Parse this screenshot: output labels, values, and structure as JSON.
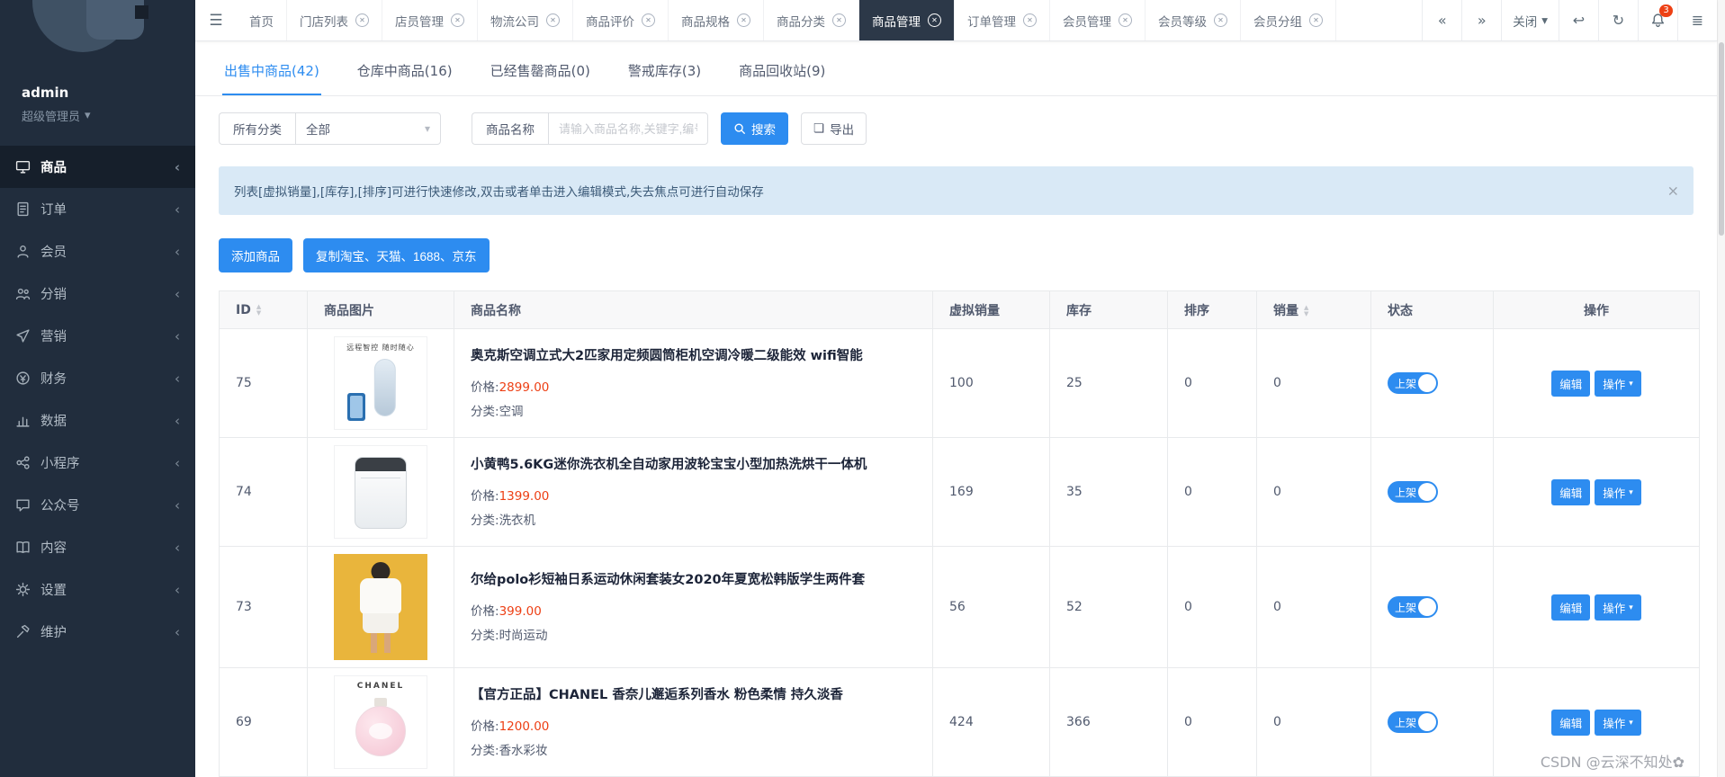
{
  "colors": {
    "accent": "#2d8cf0",
    "price_red": "#ed3f14",
    "sidebar_bg": "#212d3d",
    "badge_red": "#ed4014"
  },
  "icons": {
    "hamburger": "☰",
    "tab_close": "✕",
    "caret_down": "▾",
    "chevron_collapse": "‹",
    "nav_back": "«",
    "nav_forward": "»",
    "undo": "↩",
    "refresh": "↻",
    "list": "≣",
    "sort_up": "▲",
    "sort_down": "▼",
    "export": "❏",
    "close": "×"
  },
  "sidebar": {
    "user_name": "admin",
    "user_role": "超级管理员",
    "items": [
      {
        "label": "商品"
      },
      {
        "label": "订单"
      },
      {
        "label": "会员"
      },
      {
        "label": "分销"
      },
      {
        "label": "营销"
      },
      {
        "label": "财务"
      },
      {
        "label": "数据"
      },
      {
        "label": "小程序"
      },
      {
        "label": "公众号"
      },
      {
        "label": "内容"
      },
      {
        "label": "设置"
      },
      {
        "label": "维护"
      }
    ]
  },
  "navbar": {
    "tabs": [
      {
        "label": "首页"
      },
      {
        "label": "门店列表"
      },
      {
        "label": "店员管理"
      },
      {
        "label": "物流公司"
      },
      {
        "label": "商品评价"
      },
      {
        "label": "商品规格"
      },
      {
        "label": "商品分类"
      },
      {
        "label": "商品管理"
      },
      {
        "label": "订单管理"
      },
      {
        "label": "会员管理"
      },
      {
        "label": "会员等级"
      },
      {
        "label": "会员分组"
      }
    ],
    "close_menu_label": "关闭",
    "notification_count": "3"
  },
  "subtabs": [
    {
      "label": "出售中商品(42)"
    },
    {
      "label": "仓库中商品(16)"
    },
    {
      "label": "已经售罄商品(0)"
    },
    {
      "label": "警戒库存(3)"
    },
    {
      "label": "商品回收站(9)"
    }
  ],
  "filters": {
    "category_label": "所有分类",
    "category_value": "全部",
    "name_label": "商品名称",
    "name_placeholder": "请输入商品名称,关键字,编号",
    "search_label": "搜索",
    "export_label": "导出"
  },
  "alert": {
    "text": "列表[虚拟销量],[库存],[排序]可进行快速修改,双击或者单击进入编辑模式,失去焦点可进行自动保存"
  },
  "toolbar": {
    "add_label": "添加商品",
    "copy_label": "复制淘宝、天猫、1688、京东"
  },
  "table": {
    "columns": {
      "id": "ID",
      "image": "商品图片",
      "name": "商品名称",
      "virtual_sales": "虚拟销量",
      "stock": "库存",
      "sort": "排序",
      "sales": "销量",
      "status": "状态",
      "actions": "操作"
    },
    "price_label": "价格:",
    "category_label": "分类:",
    "edit_label": "编辑",
    "action_label": "操作",
    "status_on_label": "上架",
    "rows": [
      {
        "id": "75",
        "name": "奥克斯空调立式大2匹家用定频圆筒柜机空调冷暖二级能效 wifi智能",
        "price": "2899.00",
        "category": "空调",
        "virtual_sales": "100",
        "stock": "25",
        "sort": "0",
        "sales": "0",
        "image_caption": "远程智控 随时随心"
      },
      {
        "id": "74",
        "name": "小黄鸭5.6KG迷你洗衣机全自动家用波轮宝宝小型加热洗烘干一体机",
        "price": "1399.00",
        "category": "洗衣机",
        "virtual_sales": "169",
        "stock": "35",
        "sort": "0",
        "sales": "0"
      },
      {
        "id": "73",
        "name": "尔给polo衫短袖日系运动休闲套装女2020年夏宽松韩版学生两件套",
        "price": "399.00",
        "category": "时尚运动",
        "virtual_sales": "56",
        "stock": "52",
        "sort": "0",
        "sales": "0"
      },
      {
        "id": "69",
        "name": "【官方正品】CHANEL 香奈儿邂逅系列香水 粉色柔情 持久淡香",
        "price": "1200.00",
        "category": "香水彩妆",
        "virtual_sales": "424",
        "stock": "366",
        "sort": "0",
        "sales": "0",
        "image_caption": "CHANEL"
      }
    ]
  },
  "watermark": "CSDN @云深不知处✿"
}
